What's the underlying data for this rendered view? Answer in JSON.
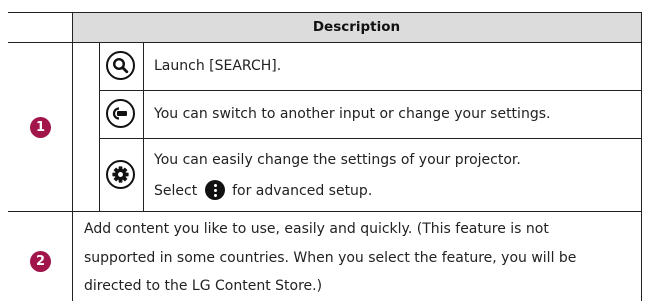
{
  "table": {
    "header": "Description",
    "rows": [
      {
        "number": "1",
        "items": [
          {
            "icon": "search-icon",
            "text": "Launch [SEARCH]."
          },
          {
            "icon": "input-icon",
            "text": "You can switch to another input or change your settings."
          },
          {
            "icon": "settings-gear-icon",
            "text_line1": "You can easily change the settings of your projector.",
            "text_line2_before": "Select",
            "text_line2_icon": "more-options-icon",
            "text_line2_after": "for advanced setup."
          }
        ]
      },
      {
        "number": "2",
        "lines": [
          "Add content you like to use, easily and quickly. (This feature is not",
          "supported in some countries. When you select the feature, you will be",
          "directed to the LG Content Store.)"
        ]
      }
    ]
  },
  "colors": {
    "badge": "#a1154a",
    "header_bg": "#dcdcdc",
    "border": "#222222"
  }
}
